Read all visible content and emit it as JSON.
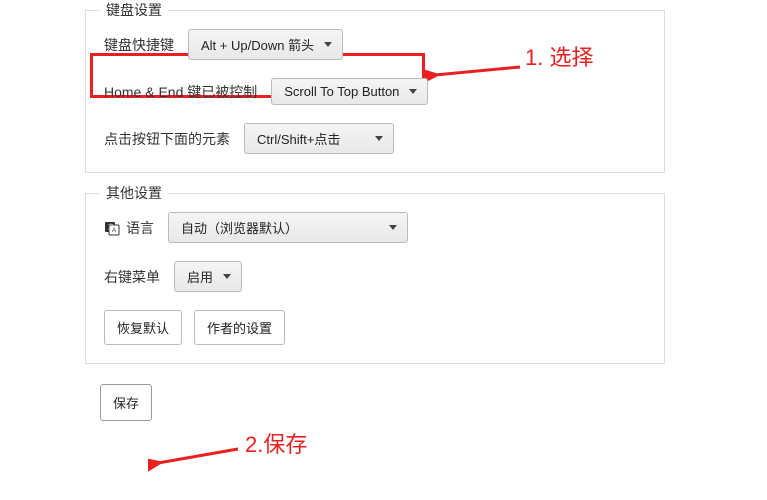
{
  "keyboard_section": {
    "legend": "键盘设置",
    "shortcut_label": "键盘快捷键",
    "shortcut_value": "Alt + Up/Down 箭头",
    "home_end_label": "Home & End 键已被控制",
    "home_end_value": "Scroll To Top Button",
    "click_below_label": "点击按钮下面的元素",
    "click_below_value": "Ctrl/Shift+点击"
  },
  "other_section": {
    "legend": "其他设置",
    "language_label": "语言",
    "language_value": "自动（浏览器默认）",
    "context_menu_label": "右键菜单",
    "context_menu_value": "启用",
    "restore_defaults": "恢复默认",
    "author_settings": "作者的设置"
  },
  "save_button": "保存",
  "annotations": {
    "step1": "1. 选择",
    "step2": "2.保存"
  }
}
